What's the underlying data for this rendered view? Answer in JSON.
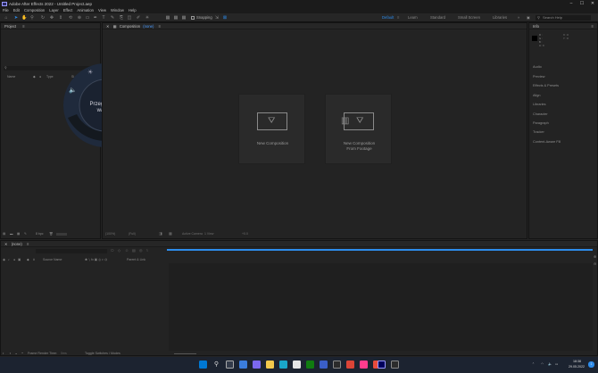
{
  "window": {
    "title": "Adobe After Effects 2022 - Untitled Project.aep",
    "minimize": "–",
    "maximize": "☐",
    "close": "✕"
  },
  "menu": [
    "File",
    "Edit",
    "Composition",
    "Layer",
    "Effect",
    "Animation",
    "View",
    "Window",
    "Help"
  ],
  "toolbar": {
    "snapping_label": "Snapping",
    "workspaces": [
      {
        "label": "Default",
        "active": true
      },
      {
        "label": "Learn",
        "active": false
      },
      {
        "label": "Standard",
        "active": false
      },
      {
        "label": "Small Screen",
        "active": false
      },
      {
        "label": "Libraries",
        "active": false
      }
    ],
    "more": "»",
    "search_placeholder": "Search Help"
  },
  "project_panel": {
    "title": "Project",
    "columns": {
      "name": "Name",
      "type": "Type",
      "size": "Si"
    },
    "footer_bpc": "8 bpc"
  },
  "radial_menu": {
    "center_line1": "Przeglądanie",
    "center_line2": "warstw",
    "ring_color": "#1f2a3c",
    "highlight_color": "#e8c9a6"
  },
  "composition_panel": {
    "title": "Composition",
    "comp_name": "(none)",
    "buttons": [
      {
        "label": "New Composition",
        "label2": ""
      },
      {
        "label": "New Composition",
        "label2": "From Footage"
      }
    ],
    "footer": {
      "zoom": "(100%)",
      "res": "(Full)",
      "view": "1 View",
      "camera": "Active Camera",
      "value": "+0.0"
    }
  },
  "info_panel": {
    "title": "Info",
    "rgb": [
      "R :",
      "G :",
      "B :",
      "A : 0"
    ],
    "xy": [
      "X : 0",
      "Y : 0"
    ],
    "items": [
      "Audio",
      "Preview",
      "Effects & Presets",
      "Align",
      "Libraries",
      "Character",
      "Paragraph",
      "Tracker",
      "Content-Aware Fill"
    ]
  },
  "timeline_panel": {
    "title": "(none)",
    "columns": {
      "source": "Source Name",
      "parent": "Parent & Link"
    },
    "footer": {
      "render_time_label": "Frame Render Time:",
      "render_time_value": "0ms",
      "toggle": "Toggle Switches / Modes"
    }
  },
  "taskbar": {
    "time": "18:38",
    "date": "29.05.2022",
    "notification_count": "1"
  },
  "colors": {
    "accent_blue": "#2d8ceb",
    "ae_purple": "#9999ff",
    "comp_label_blue": "#4a9bff"
  }
}
